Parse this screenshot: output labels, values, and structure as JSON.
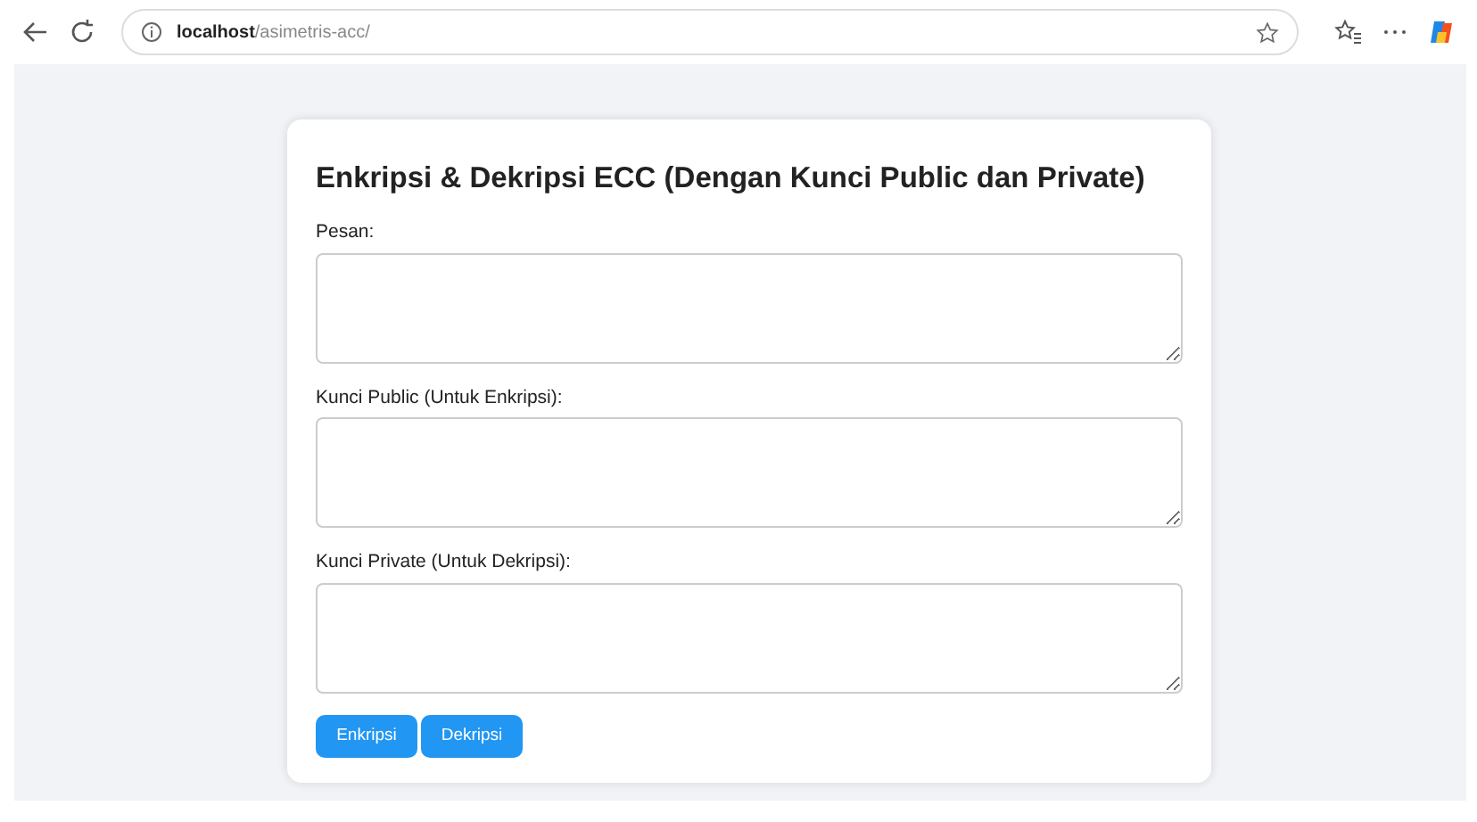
{
  "browser": {
    "address": "**localhost**/asimetris-acc/"
  },
  "form": {
    "title": "Enkripsi & Dekripsi ECC (Dengan Kunci Public dan Private)",
    "fields": [
      {
        "label": "Pesan:"
      },
      {
        "label": "Kunci Public (Untuk Enkripsi):"
      },
      {
        "label": "Kunci Private (Untuk Dekripsi):"
      }
    ],
    "buttons": [
      "Enkripsi",
      "Dekripsi"
    ]
  }
}
